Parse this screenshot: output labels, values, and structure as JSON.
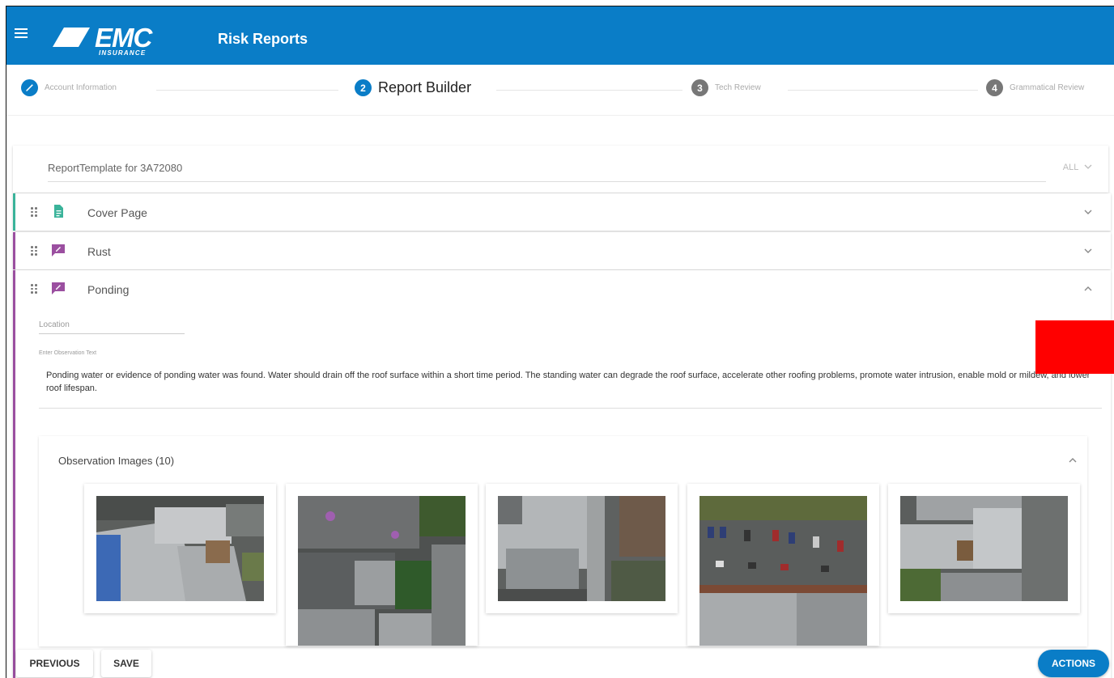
{
  "header": {
    "logo_text": "EMC",
    "logo_subtext": "INSURANCE",
    "app_title": "Risk Reports",
    "color": "#0a7dc7"
  },
  "stepper": {
    "steps": [
      {
        "number": "",
        "label": "Account Information",
        "state": "done",
        "icon": "pencil-icon"
      },
      {
        "number": "2",
        "label": "Report Builder",
        "state": "active"
      },
      {
        "number": "3",
        "label": "Tech Review",
        "state": "pending"
      },
      {
        "number": "4",
        "label": "Grammatical Review",
        "state": "pending"
      }
    ]
  },
  "template": {
    "title": "ReportTemplate for 3A72080",
    "filter": "ALL"
  },
  "sections": [
    {
      "label": "Cover Page",
      "icon": "document-icon",
      "color": "#3ab39a",
      "expanded": false
    },
    {
      "label": "Rust",
      "icon": "comment-edit-icon",
      "color": "#9b4fa0",
      "expanded": false
    },
    {
      "label": "Ponding",
      "icon": "comment-edit-icon",
      "color": "#9b4fa0",
      "expanded": true
    }
  ],
  "ponding": {
    "location_label": "Location",
    "observation_label": "Enter Observation Text",
    "observation_text": "Ponding water or evidence of ponding water was found.  Water should drain off the roof surface within a short time period. The standing water can degrade the roof surface, accelerate other roofing problems, promote water intrusion, enable mold or mildew, and lower roof lifespan.",
    "images_title": "Observation Images (10)"
  },
  "buttons": {
    "previous": "PREVIOUS",
    "save": "SAVE",
    "actions": "ACTIONS"
  }
}
